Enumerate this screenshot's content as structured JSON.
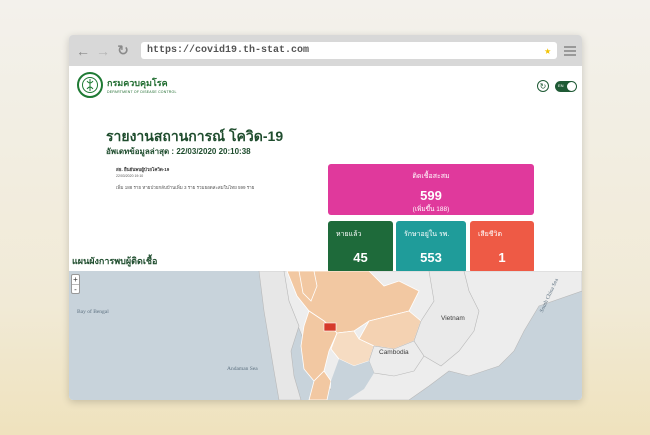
{
  "browser": {
    "url": "https://covid19.th-stat.com"
  },
  "header": {
    "logo_th": "กรมควบคุมโรค",
    "logo_en": "DEPARTMENT OF DISEASE CONTROL",
    "toggle_label": "EN"
  },
  "report": {
    "title": "รายงานสถานการณ์ โควิด-19",
    "updated": "อัพเดทข้อมูลล่าสุด : 22/03/2020 20:10:38",
    "announce_title": "สธ. ยืนยันพบผู้ป่วยโควิด-19",
    "announce_date": "22/03/2020 19:10",
    "announce_body": "เพิ่ม 188 ราย หายป่วยกลับบ้านเพิ่ม 3 ราย รวมยอดสะสมในไทย 599 ราย"
  },
  "stats": {
    "total_label": "ติดเชื้อสะสม",
    "total_value": "599",
    "total_new": "(เพิ่มขึ้น 188)",
    "recovered_label": "หายแล้ว",
    "recovered_value": "45",
    "hospital_label": "รักษาอยู่ใน รพ.",
    "hospital_value": "553",
    "death_label": "เสียชีวิต",
    "death_value": "1",
    "colors": {
      "total": "#e0399c",
      "recovered": "#1e6a3a",
      "hospital": "#1f9c9a",
      "death": "#ee5a45"
    }
  },
  "map": {
    "title": "แผนผังการพบผู้ติดเชื้อ",
    "zoom_in": "+",
    "zoom_out": "-",
    "labels": {
      "bay_of_bengal": "Bay of Bengal",
      "vietnam": "Vietnam",
      "cambodia": "Cambodia",
      "andaman_sea": "Andaman Sea",
      "south_china_sea": "South China Sea"
    }
  }
}
